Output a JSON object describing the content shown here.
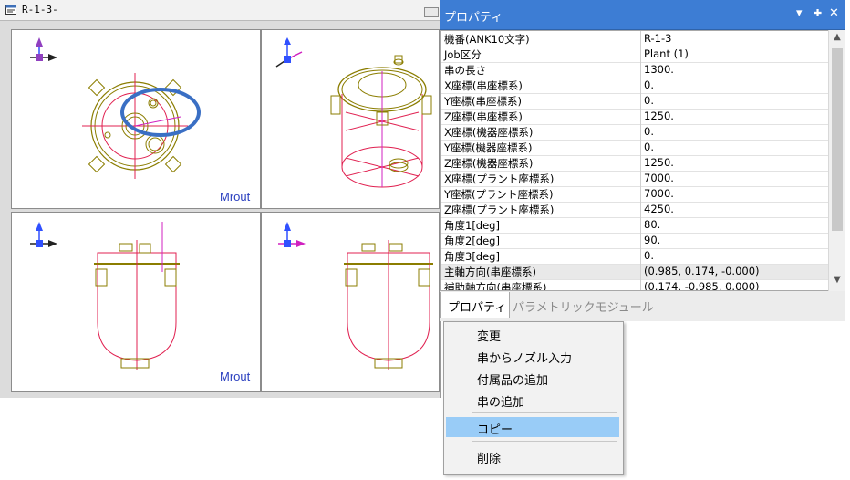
{
  "cad_window": {
    "title": "R-1-3-",
    "viewports": [
      {
        "name": "top",
        "axes": [
          "Y",
          "X"
        ],
        "label": "Mrout"
      },
      {
        "name": "iso",
        "axes": [
          "Z",
          "Y"
        ],
        "label": ""
      },
      {
        "name": "front",
        "axes": [
          "Z",
          "X"
        ],
        "label": "Mrout"
      },
      {
        "name": "side",
        "axes": [
          "Z",
          "Y"
        ],
        "label": ""
      }
    ]
  },
  "properties_panel": {
    "title": "プロパティ",
    "title_icons": [
      "dropdown-icon",
      "pin-icon",
      "close-icon"
    ],
    "rows": [
      {
        "key": "機番(ANK10文字)",
        "value": "R-1-3"
      },
      {
        "key": "Job区分",
        "value": "Plant (1)"
      },
      {
        "key": "串の長さ",
        "value": "1300."
      },
      {
        "key": "X座標(串座標系)",
        "value": "0."
      },
      {
        "key": "Y座標(串座標系)",
        "value": "0."
      },
      {
        "key": "Z座標(串座標系)",
        "value": "1250."
      },
      {
        "key": "X座標(機器座標系)",
        "value": "0."
      },
      {
        "key": "Y座標(機器座標系)",
        "value": "0."
      },
      {
        "key": "Z座標(機器座標系)",
        "value": "1250."
      },
      {
        "key": "X座標(プラント座標系)",
        "value": "7000."
      },
      {
        "key": "Y座標(プラント座標系)",
        "value": "7000."
      },
      {
        "key": "Z座標(プラント座標系)",
        "value": "4250."
      },
      {
        "key": "角度1[deg]",
        "value": "80."
      },
      {
        "key": "角度2[deg]",
        "value": "90."
      },
      {
        "key": "角度3[deg]",
        "value": "0."
      },
      {
        "key": "主軸方向(串座標系)",
        "value": "(0.985, 0.174, -0.000)"
      },
      {
        "key": "補助軸方向(串座標系)",
        "value": "(0.174, -0.985, 0.000)"
      }
    ],
    "tabs": [
      {
        "label": "プロパティ",
        "active": true
      },
      {
        "label": "パラメトリックモジュール",
        "active": false
      }
    ]
  },
  "context_menu": {
    "items": [
      {
        "label": "変更"
      },
      {
        "label": "串からノズル入力"
      },
      {
        "label": "付属品の追加"
      },
      {
        "label": "串の追加"
      },
      {
        "label": "コピー",
        "highlighted": true
      },
      {
        "label": "削除"
      }
    ]
  },
  "colors": {
    "accent": "#3d7dd4",
    "menu_highlight": "#99ccf7",
    "cad_yellow": "#8b7d00",
    "cad_red": "#e02050",
    "cad_magenta": "#d020c0",
    "annotation_ellipse": "#3a6fc4"
  }
}
